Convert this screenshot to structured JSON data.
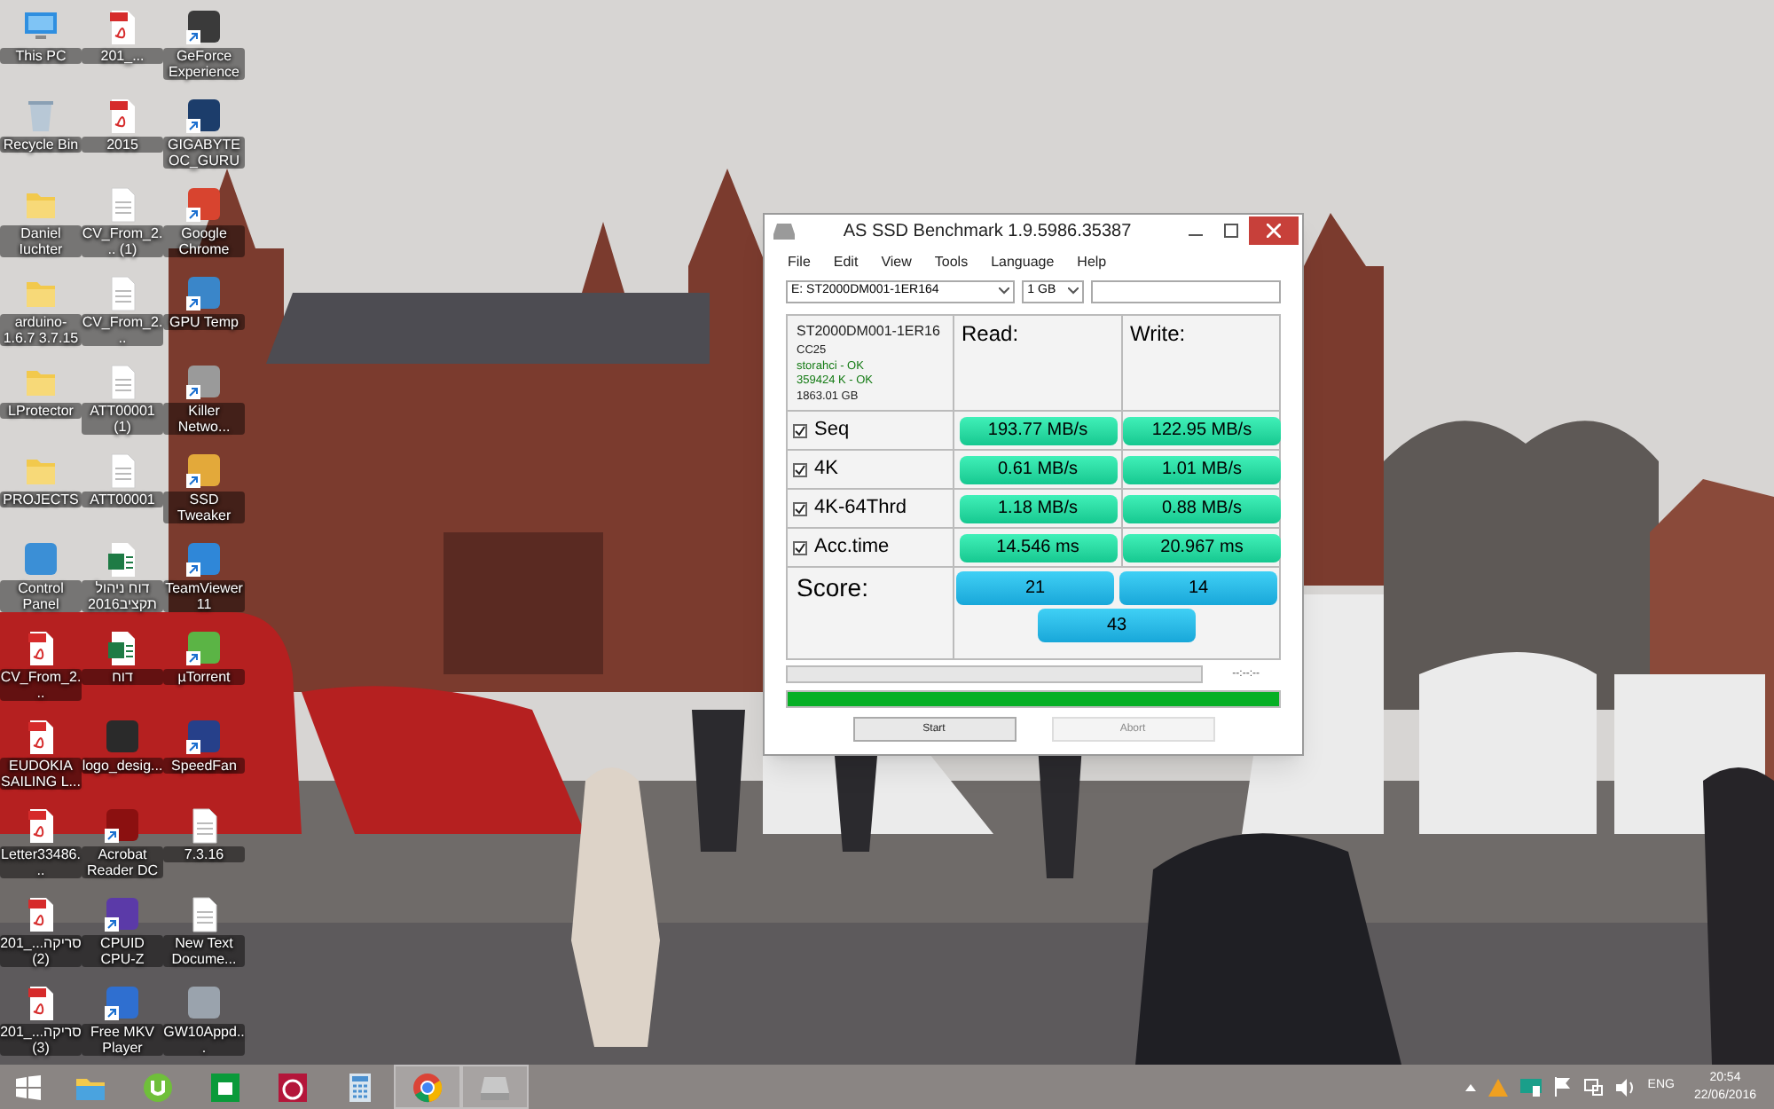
{
  "desktop_icons": [
    {
      "label": "This PC",
      "kind": "pc",
      "shortcut": false
    },
    {
      "label": "Recycle Bin",
      "kind": "bin",
      "shortcut": false
    },
    {
      "label": "Daniel Iuchter",
      "kind": "folder",
      "shortcut": false
    },
    {
      "label": "arduino-1.6.7 3.7.15",
      "kind": "folder",
      "shortcut": false
    },
    {
      "label": "LProtector",
      "kind": "folder",
      "shortcut": false
    },
    {
      "label": "PROJECTS",
      "kind": "folder",
      "shortcut": false
    },
    {
      "label": "Control Panel",
      "kind": "app",
      "color": "#3b8fd6",
      "shortcut": false
    },
    {
      "label": "CV_From_2...",
      "kind": "pdf",
      "shortcut": false
    },
    {
      "label": "EUDOKIA SAILING L...",
      "kind": "pdf",
      "shortcut": false
    },
    {
      "label": "Letter33486...",
      "kind": "pdf",
      "shortcut": false
    },
    {
      "label": "201_...סריקה (2)",
      "kind": "pdf",
      "shortcut": false
    },
    {
      "label": "201_...סריקה (3)",
      "kind": "pdf",
      "shortcut": false
    },
    {
      "label": "201_...",
      "kind": "pdf",
      "shortcut": false
    },
    {
      "label": "2015",
      "kind": "pdf",
      "shortcut": false
    },
    {
      "label": "CV_From_2... (1)",
      "kind": "doc",
      "shortcut": false
    },
    {
      "label": "CV_From_2...",
      "kind": "doc",
      "shortcut": false
    },
    {
      "label": "ATT00001 (1)",
      "kind": "doc",
      "shortcut": false
    },
    {
      "label": "ATT00001",
      "kind": "doc",
      "shortcut": false
    },
    {
      "label": "דוח ניהול תקציב2016",
      "kind": "excel",
      "shortcut": false
    },
    {
      "label": "דוח",
      "kind": "excel",
      "shortcut": false
    },
    {
      "label": "logo_desig...",
      "kind": "app",
      "color": "#2a2a2a",
      "shortcut": false
    },
    {
      "label": "Acrobat Reader DC",
      "kind": "app",
      "color": "#8b1010",
      "shortcut": true
    },
    {
      "label": "CPUID CPU-Z",
      "kind": "app",
      "color": "#5b3aa8",
      "shortcut": true
    },
    {
      "label": "Free MKV Player",
      "kind": "app",
      "color": "#2f6fd0",
      "shortcut": true
    },
    {
      "label": "GeForce Experience",
      "kind": "app",
      "color": "#3a3a3a",
      "shortcut": true
    },
    {
      "label": "GIGABYTE OC_GURU",
      "kind": "app",
      "color": "#1c3d6b",
      "shortcut": true
    },
    {
      "label": "Google Chrome",
      "kind": "app",
      "color": "#d8442f",
      "shortcut": true
    },
    {
      "label": "GPU Temp",
      "kind": "app",
      "color": "#3a86c9",
      "shortcut": true
    },
    {
      "label": "Killer Netwo...",
      "kind": "app",
      "color": "#9a9a9a",
      "shortcut": true
    },
    {
      "label": "SSD Tweaker",
      "kind": "app",
      "color": "#e3a93a",
      "shortcut": true
    },
    {
      "label": "TeamViewer 11",
      "kind": "app",
      "color": "#2f87d8",
      "shortcut": true
    },
    {
      "label": "µTorrent",
      "kind": "app",
      "color": "#5bb445",
      "shortcut": true
    },
    {
      "label": "SpeedFan",
      "kind": "app",
      "color": "#26408a",
      "shortcut": true
    },
    {
      "label": "7.3.16",
      "kind": "doc",
      "shortcut": false
    },
    {
      "label": "New Text Docume...",
      "kind": "doc",
      "shortcut": false
    },
    {
      "label": "GW10Appd...",
      "kind": "app",
      "color": "#9aa3ad",
      "shortcut": false
    }
  ],
  "window": {
    "title": "AS SSD Benchmark 1.9.5986.35387",
    "menu": [
      "File",
      "Edit",
      "View",
      "Tools",
      "Language",
      "Help"
    ],
    "drive_select": "E: ST2000DM001-1ER164",
    "size_select": "1 GB",
    "drive_info": [
      {
        "text": "ST2000DM001-1ER16",
        "ok": false
      },
      {
        "text": "CC25",
        "ok": false
      },
      {
        "text": "storahci - OK",
        "ok": true
      },
      {
        "text": "359424 K - OK",
        "ok": true
      },
      {
        "text": "1863.01 GB",
        "ok": false
      }
    ],
    "read_header": "Read:",
    "write_header": "Write:",
    "rows": [
      {
        "label": "Seq",
        "checked": true,
        "read": "193.77 MB/s",
        "write": "122.95 MB/s"
      },
      {
        "label": "4K",
        "checked": true,
        "read": "0.61 MB/s",
        "write": "1.01 MB/s"
      },
      {
        "label": "4K-64Thrd",
        "checked": true,
        "read": "1.18 MB/s",
        "write": "0.88 MB/s"
      },
      {
        "label": "Acc.time",
        "checked": true,
        "read": "14.546 ms",
        "write": "20.967 ms"
      }
    ],
    "score_label": "Score:",
    "score_read": "21",
    "score_write": "14",
    "score_total": "43",
    "test_progress": {
      "level": 0
    },
    "elapsed": "--:--:--",
    "total_progress": {
      "level": 1
    },
    "buttons": [
      {
        "label": "Start",
        "disabled": false
      },
      {
        "label": "Abort",
        "disabled": true
      }
    ]
  },
  "taskbar": {
    "apps": [
      {
        "kind": "explorer",
        "active": false
      },
      {
        "kind": "torrent",
        "active": false
      },
      {
        "kind": "store",
        "active": false
      },
      {
        "kind": "alarm",
        "active": false
      },
      {
        "kind": "calculator",
        "active": false
      },
      {
        "kind": "browser",
        "active": true
      },
      {
        "kind": "drive",
        "active": true
      }
    ],
    "language": "ENG",
    "time": "20:54",
    "date": "22/06/2016"
  }
}
